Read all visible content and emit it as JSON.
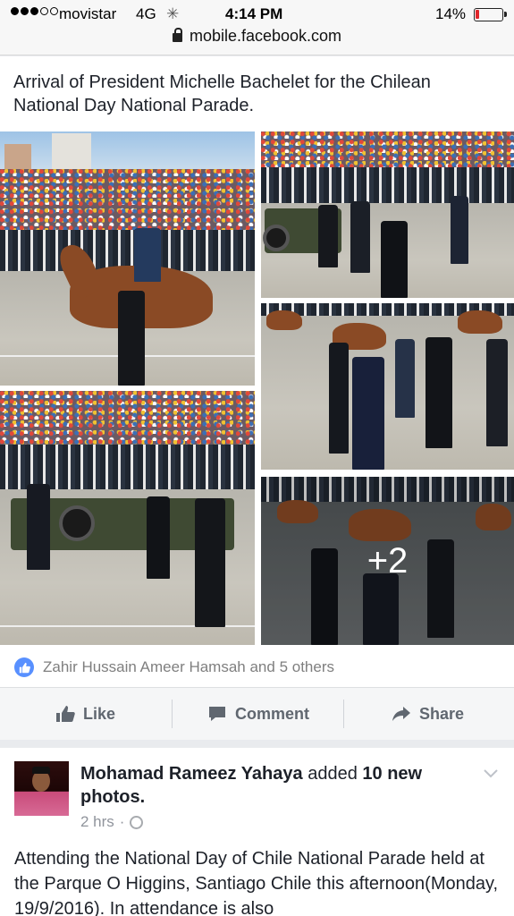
{
  "status_bar": {
    "carrier": "movistar",
    "network": "4G",
    "time": "4:14 PM",
    "battery_percent": "14%",
    "battery_level": 0.14,
    "signal_bars_filled": 3,
    "signal_bars_total": 5,
    "battery_color": "#e0262b"
  },
  "browser": {
    "url": "mobile.facebook.com",
    "lock_icon": "lock-icon"
  },
  "post1": {
    "caption": "Arrival of President Michelle Bachelet for the Chilean National Day National Parade.",
    "photos": [
      {
        "scene": "horse-guard"
      },
      {
        "scene": "jeep-officials"
      },
      {
        "scene": "jeep-convoy"
      },
      {
        "scene": "officials-walking"
      },
      {
        "scene": "officials-more",
        "overlay": "+2"
      }
    ],
    "likes_text": "Zahir Hussain Ameer Hamsah and 5 others",
    "actions": {
      "like": "Like",
      "comment": "Comment",
      "share": "Share"
    },
    "accent_color": "#5890ff"
  },
  "post2": {
    "author": "Mohamad Rameez Yahaya",
    "action_prefix": "added",
    "action_count": "10 new",
    "action_suffix": "photos.",
    "time": "2 hrs",
    "separator": "·",
    "body": "Attending the National Day of Chile National Parade held at the Parque O Higgins, Santiago Chile this afternoon(Monday, 19/9/2016). In attendance is also"
  }
}
